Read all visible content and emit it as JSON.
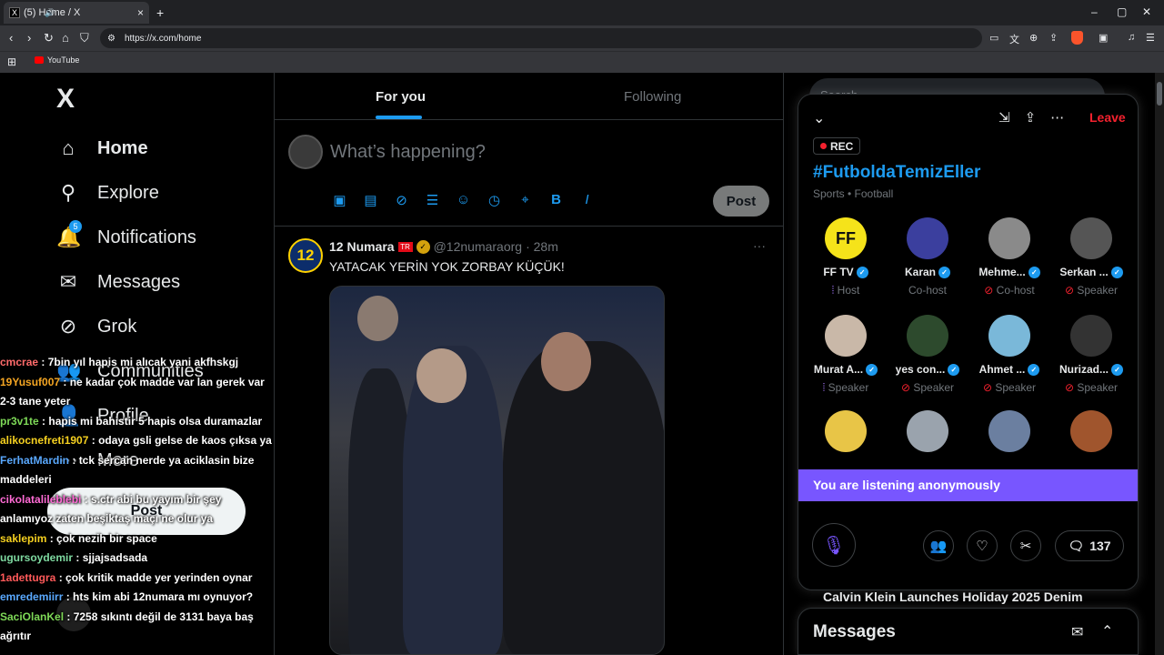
{
  "browser": {
    "tab_title": "(5) Home / X",
    "tab_favicon": "X",
    "tab_close": "×",
    "new_tab": "+",
    "url": "https://x.com/home",
    "bookmarks": [
      {
        "label": "YouTube"
      }
    ],
    "window_controls": [
      "–",
      "▢",
      "✕"
    ],
    "nav": [
      "‹",
      "›",
      "↻",
      "⌂",
      "⛉"
    ]
  },
  "sidebar": {
    "logo": "X",
    "items": [
      {
        "label": "Home",
        "icon": "home-icon",
        "glyph": "⌂"
      },
      {
        "label": "Explore",
        "icon": "search-icon",
        "glyph": "⚲"
      },
      {
        "label": "Notifications",
        "icon": "bell-icon",
        "glyph": "🔔"
      },
      {
        "label": "Messages",
        "icon": "envelope-icon",
        "glyph": "✉"
      },
      {
        "label": "Grok",
        "icon": "grok-icon",
        "glyph": "⊘"
      },
      {
        "label": "Communities",
        "icon": "communities-icon",
        "glyph": "👥"
      },
      {
        "label": "Profile",
        "icon": "profile-icon",
        "glyph": "👤"
      },
      {
        "label": "More",
        "icon": "more-icon",
        "glyph": "⋯"
      }
    ],
    "notification_count": "5",
    "post_button": "Post"
  },
  "chat_overlay": [
    {
      "user": "cmcrae",
      "text": ": 7bin yıl hapis mi alıcak yani akfhskgj",
      "color": "#ff6b6b"
    },
    {
      "user": "19Yusuf007",
      "text": ": ne kadar çok madde var lan gerek var 2-3 tane yeter",
      "color": "#f5a623"
    },
    {
      "user": "pr3v1te",
      "text": ": hapis mi bahistir 5 hapis olsa duramazlar",
      "color": "#7ed957"
    },
    {
      "user": "alikocnefreti1907",
      "text": ": odaya gsli gelse de kaos çıksa ya",
      "color": "#f5d020"
    },
    {
      "user": "FerhatMardin",
      "text": ": tck sercan nerde ya aciklasin bize maddeleri",
      "color": "#5aa9ff"
    },
    {
      "user": "cikolatalileblebi",
      "text": ": s.ctr abi bu yayım bir şey anlamıyoz zaten beşiktaş maçı ne olur ya",
      "color": "#ff6bd5"
    },
    {
      "user": "saklepim",
      "text": ": çok nezih bir space",
      "color": "#f5d020"
    },
    {
      "user": "ugursoydemir",
      "text": ": sjjajsadsada",
      "color": "#7ed9a0"
    },
    {
      "user": "1adettugra",
      "text": ": çok kritik madde yer yerinden oynar",
      "color": "#ff5a5a"
    },
    {
      "user": "emredemiirr",
      "text": ": hts kim abi 12numara mı oynuyor?",
      "color": "#5aa9ff"
    },
    {
      "user": "SaciOlanKel",
      "text": ": 7258 sıkıntı değil de 3131 baya baş ağrıtır",
      "color": "#7ed957"
    }
  ],
  "feed": {
    "tabs": [
      {
        "label": "For you",
        "active": true
      },
      {
        "label": "Following",
        "active": false
      }
    ],
    "composer_placeholder": "What’s happening?",
    "composer_post": "Post",
    "tweet": {
      "avatar_text": "12",
      "name": "12 Numara",
      "flag": "TR",
      "handle": "@12numaraorg",
      "time": "· 28m",
      "text": "YATACAK YERİN YOK ZORBAY KÜÇÜK!",
      "more": "···"
    }
  },
  "search_placeholder": "Search",
  "space": {
    "leave": "Leave",
    "rec": "REC",
    "title": "#FutboldaTemizEller",
    "topic": "Sports • Football",
    "speakers": [
      {
        "name": "FF TV",
        "role": "Host",
        "role_icon": "mic",
        "avatar": "FF",
        "bg": "#f5e31a",
        "fg": "#111"
      },
      {
        "name": "Karan",
        "role": "Co-host",
        "role_icon": "none",
        "avatar": "",
        "bg": "#3b3f9e",
        "fg": "#fff"
      },
      {
        "name": "Mehme...",
        "role": "Co-host",
        "role_icon": "muted",
        "avatar": "",
        "bg": "#8a8a8a",
        "fg": "#fff"
      },
      {
        "name": "Serkan ...",
        "role": "Speaker",
        "role_icon": "muted",
        "avatar": "",
        "bg": "#555",
        "fg": "#fff"
      },
      {
        "name": "Murat A...",
        "role": "Speaker",
        "role_icon": "mic",
        "avatar": "",
        "bg": "#c9b8a8",
        "fg": "#fff"
      },
      {
        "name": "yes con...",
        "role": "Speaker",
        "role_icon": "muted",
        "avatar": "",
        "bg": "#2d4a2d",
        "fg": "#fff"
      },
      {
        "name": "Ahmet ...",
        "role": "Speaker",
        "role_icon": "muted",
        "avatar": "",
        "bg": "#7ab8d9",
        "fg": "#fff"
      },
      {
        "name": "Nurizad...",
        "role": "Speaker",
        "role_icon": "muted",
        "avatar": "",
        "bg": "#333",
        "fg": "#fff"
      },
      {
        "name": "",
        "role": "",
        "role_icon": "none",
        "avatar": "",
        "bg": "#e8c547",
        "fg": "#fff"
      },
      {
        "name": "",
        "role": "",
        "role_icon": "none",
        "avatar": "",
        "bg": "#9aa3ad",
        "fg": "#fff"
      },
      {
        "name": "",
        "role": "",
        "role_icon": "none",
        "avatar": "",
        "bg": "#6b7fa0",
        "fg": "#fff"
      },
      {
        "name": "",
        "role": "",
        "role_icon": "none",
        "avatar": "",
        "bg": "#a0552d",
        "fg": "#fff"
      }
    ],
    "listening_text": "You are listening anonymously",
    "comment_count": "137"
  },
  "trend": "Calvin Klein Launches Holiday 2025 Denim",
  "messages_drawer": "Messages",
  "colors": {
    "accent": "#1d9bf0",
    "leave": "#f4212e",
    "purple": "#7856ff"
  }
}
